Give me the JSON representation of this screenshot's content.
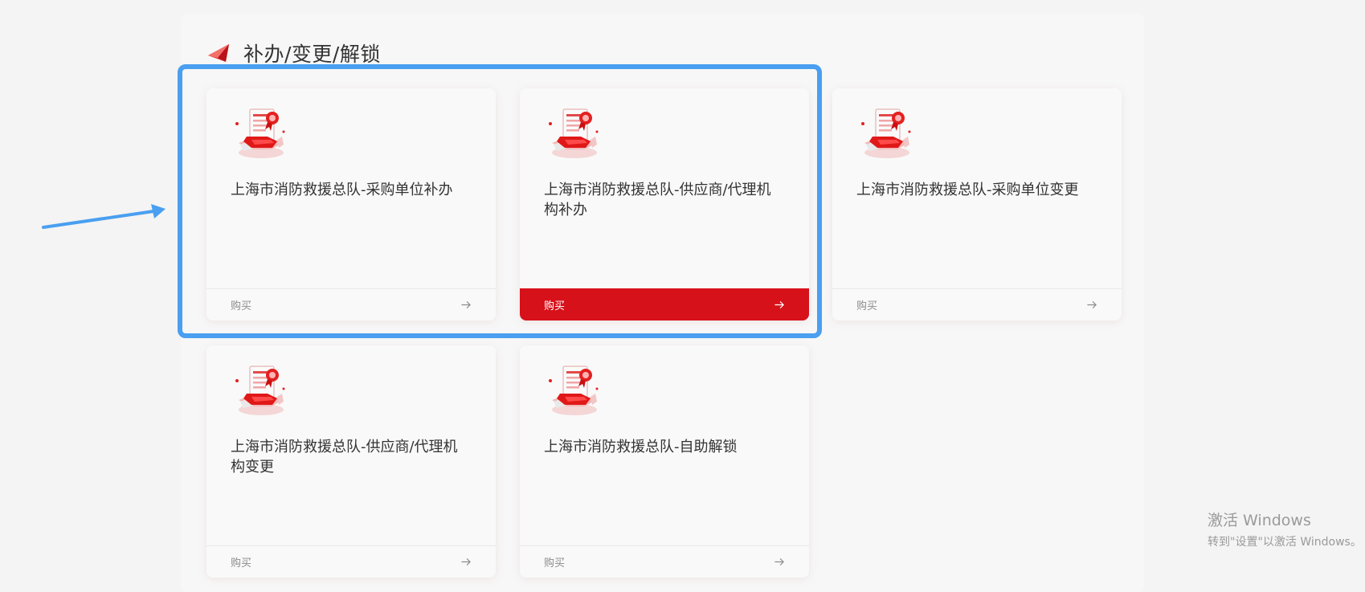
{
  "section": {
    "title": "补办/变更/解锁",
    "icon": "red-paper-plane-icon"
  },
  "cards": [
    {
      "title": "上海市消防救援总队-采购单位补办",
      "action": "购买",
      "icon": "certificate-document-icon",
      "active": false
    },
    {
      "title": "上海市消防救援总队-供应商/代理机构补办",
      "action": "购买",
      "icon": "certificate-document-icon",
      "active": true
    },
    {
      "title": "上海市消防救援总队-采购单位变更",
      "action": "购买",
      "icon": "certificate-document-icon",
      "active": false
    },
    {
      "title": "上海市消防救援总队-供应商/代理机构变更",
      "action": "购买",
      "icon": "certificate-document-icon",
      "active": false
    },
    {
      "title": "上海市消防救援总队-自助解锁",
      "action": "购买",
      "icon": "certificate-document-icon",
      "active": false
    }
  ],
  "colors": {
    "accent": "#d7111a",
    "highlight": "#4a9ff0"
  },
  "watermark": {
    "title": "激活 Windows",
    "subtitle": "转到\"设置\"以激活 Windows。"
  }
}
